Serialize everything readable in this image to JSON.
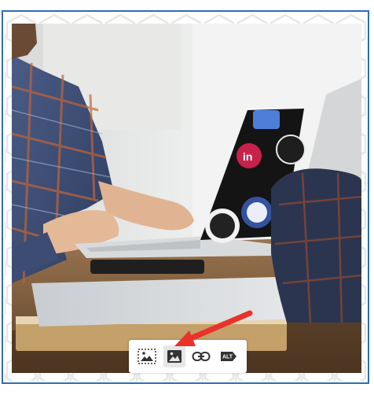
{
  "toolbar": {
    "buttons": [
      {
        "icon": "image-crop-icon",
        "active": false
      },
      {
        "icon": "image-icon",
        "active": true
      },
      {
        "icon": "link-icon",
        "active": false
      },
      {
        "icon": "alt-tag-icon",
        "label": "ALT",
        "active": false
      }
    ]
  },
  "annotation": {
    "arrow_color": "#e8322b"
  },
  "colors": {
    "frame_border": "#2f6db4",
    "hex_pattern": "#e7e7e7"
  }
}
